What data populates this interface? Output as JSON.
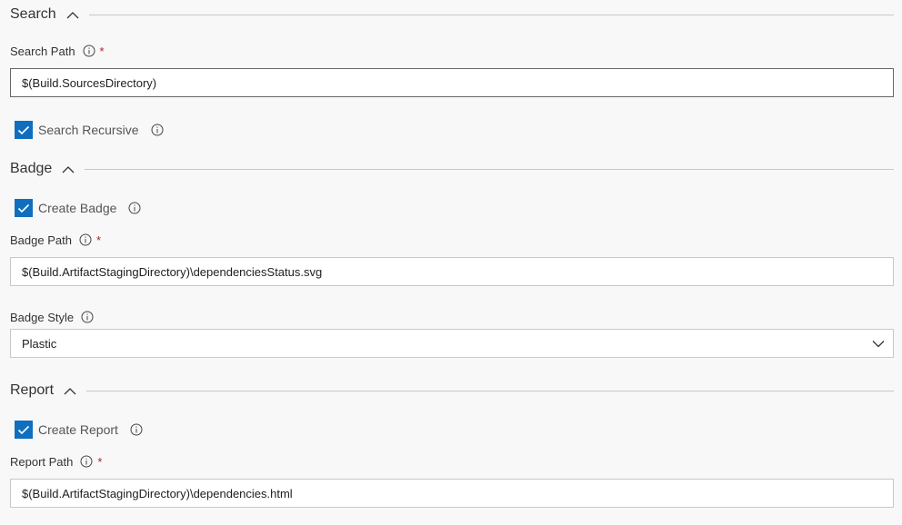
{
  "colors": {
    "accent": "#106ebe",
    "required": "#a4262c",
    "background": "#f8f8f8",
    "border": "#c8c8c8"
  },
  "search": {
    "title": "Search",
    "path_label": "Search Path",
    "path_value": "$(Build.SourcesDirectory)",
    "recursive_label": "Search Recursive",
    "recursive_checked": true
  },
  "badge": {
    "title": "Badge",
    "create_label": "Create Badge",
    "create_checked": true,
    "path_label": "Badge Path",
    "path_value": "$(Build.ArtifactStagingDirectory)\\dependenciesStatus.svg",
    "style_label": "Badge Style",
    "style_value": "Plastic"
  },
  "report": {
    "title": "Report",
    "create_label": "Create Report",
    "create_checked": true,
    "path_label": "Report Path",
    "path_value": "$(Build.ArtifactStagingDirectory)\\dependencies.html"
  },
  "icons": {
    "collapse": "chevron-up-icon",
    "info": "info-icon",
    "dropdown": "chevron-down-icon",
    "check": "checkmark-icon"
  },
  "required_marker": "*"
}
